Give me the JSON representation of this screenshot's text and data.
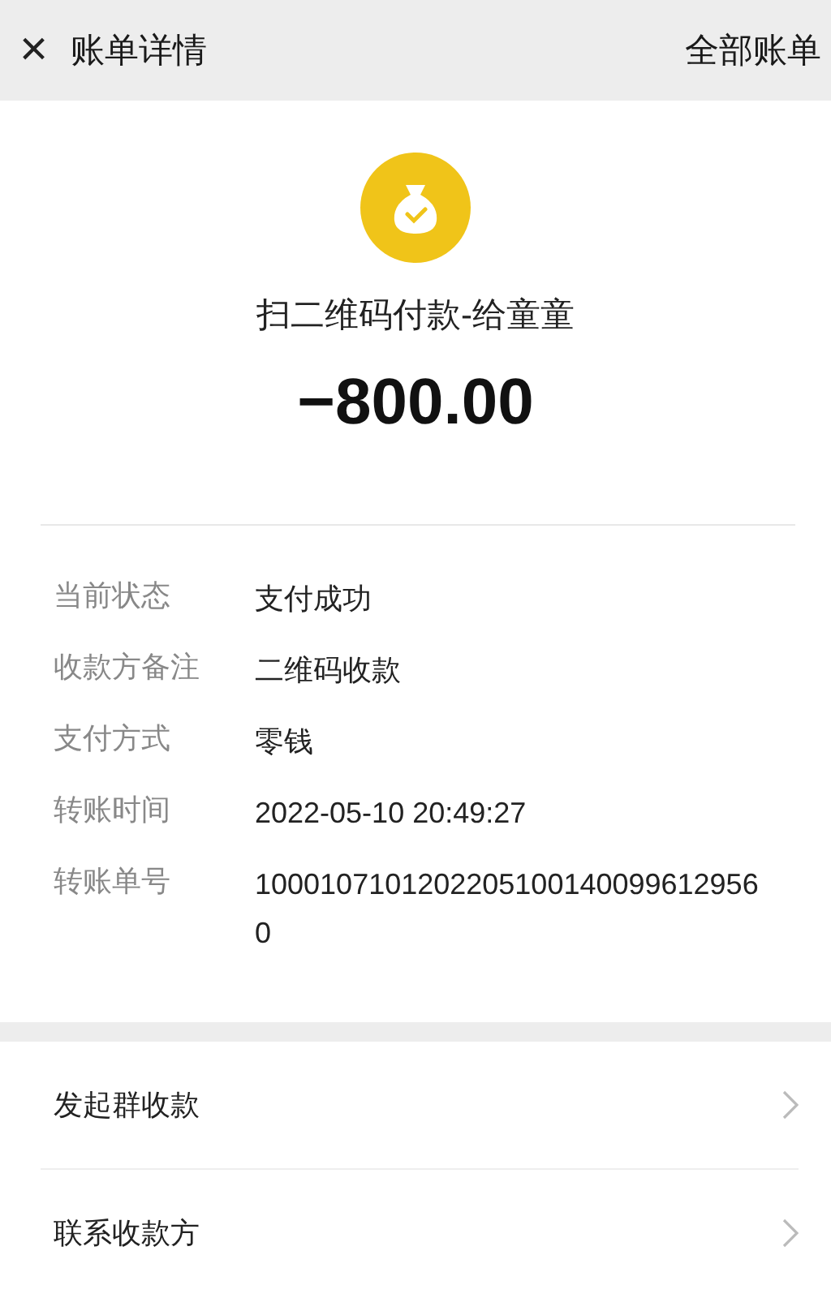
{
  "header": {
    "close": "×",
    "title": "账单详情",
    "action": "全部账单"
  },
  "summary": {
    "title": "扫二维码付款-给童童",
    "amount": "−800.00"
  },
  "details": [
    {
      "label": "当前状态",
      "value": "支付成功"
    },
    {
      "label": "收款方备注",
      "value": "二维码收款"
    },
    {
      "label": "支付方式",
      "value": "零钱"
    },
    {
      "label": "转账时间",
      "value": "2022-05-10 20:49:27"
    },
    {
      "label": "转账单号",
      "value": "10001071012022051001400996129560"
    }
  ],
  "actions": [
    {
      "label": "发起群收款"
    },
    {
      "label": "联系收款方"
    }
  ]
}
